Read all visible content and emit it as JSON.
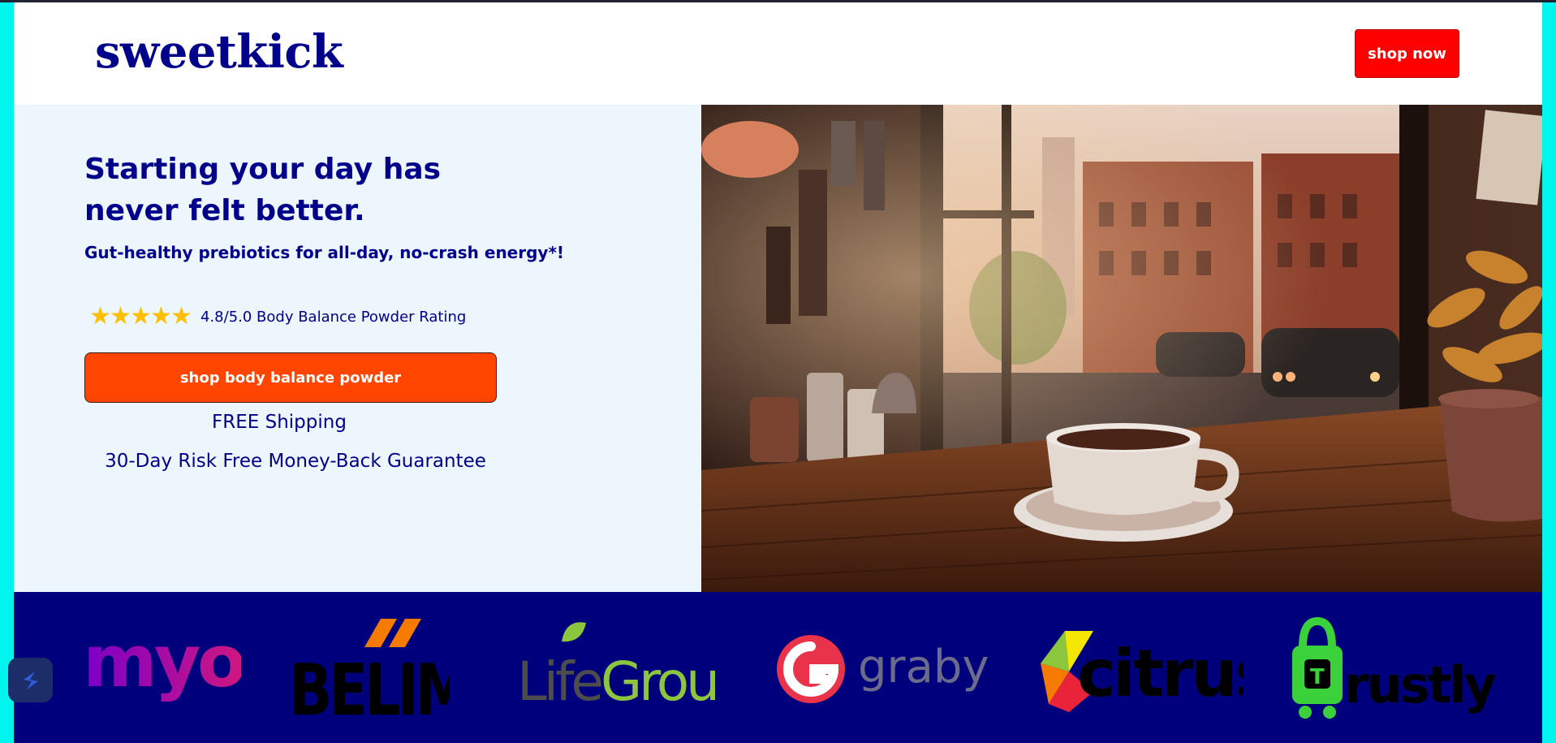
{
  "header": {
    "brand": "sweetkick",
    "shop_now_label": "shop now"
  },
  "hero": {
    "headline_line1": "Starting your day has",
    "headline_line2": "never felt better.",
    "subheadline": "Gut-healthy prebiotics for all-day, no-crash energy*!",
    "rating": {
      "stars": 5,
      "text": "4.8/5.0 Body Balance Powder Rating"
    },
    "cta_label": "shop body balance powder",
    "shipping_text": "FREE Shipping",
    "guarantee_text": "30-Day Risk Free Money-Back Guarantee",
    "image": "cafe-window-coffee-cup"
  },
  "partner_logos": [
    {
      "name": "myob",
      "icon": "myob-logo"
    },
    {
      "name": "BELIMO",
      "icon": "belimo-logo"
    },
    {
      "name": "LifeGroups",
      "icon": "lifegroups-logo"
    },
    {
      "name": "grabyo",
      "icon": "grabyo-logo"
    },
    {
      "name": "citrus",
      "icon": "citrus-logo"
    },
    {
      "name": "Trustly",
      "icon": "trustly-logo"
    }
  ],
  "colors": {
    "brand_navy": "#00008b",
    "logo_band": "#00007d",
    "cta_orange": "#ff4500",
    "shop_now_red": "#ff0000",
    "hero_left_bg": "#eef6fd",
    "frame_cyan": "#00f5ee",
    "star_gold": "#ffbf00"
  }
}
